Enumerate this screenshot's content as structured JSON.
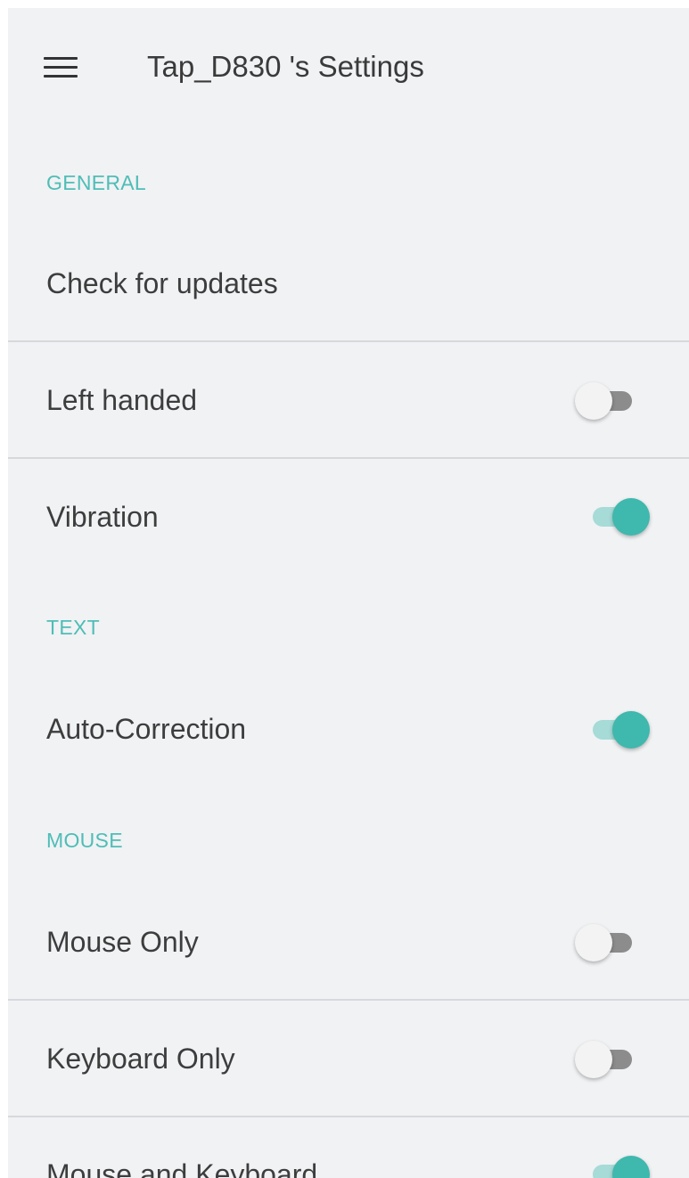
{
  "toolbar": {
    "title": "Tap_D830 's Settings",
    "menu_icon": "hamburger-menu-icon"
  },
  "accent_color": "#4fbdb6",
  "sections": {
    "general": {
      "header": "GENERAL",
      "check_updates_label": "Check for updates",
      "left_handed": {
        "label": "Left handed",
        "enabled": false
      },
      "vibration": {
        "label": "Vibration",
        "enabled": true
      }
    },
    "text": {
      "header": "TEXT",
      "auto_correction": {
        "label": "Auto-Correction",
        "enabled": true
      }
    },
    "mouse": {
      "header": "MOUSE",
      "mouse_only": {
        "label": "Mouse Only",
        "enabled": false
      },
      "keyboard_only": {
        "label": "Keyboard Only",
        "enabled": false
      },
      "mouse_and_keyboard": {
        "label": "Mouse and Keyboard",
        "enabled": true
      }
    }
  }
}
